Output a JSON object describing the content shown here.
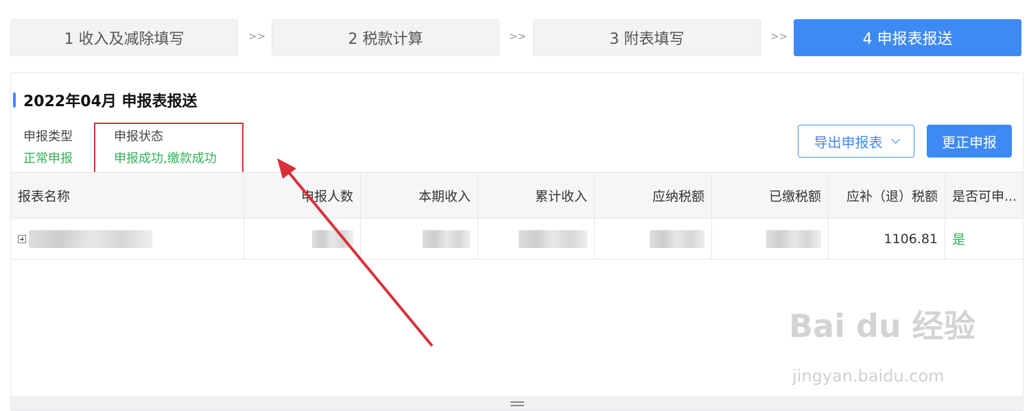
{
  "steps": [
    {
      "label": "1 收入及减除填写"
    },
    {
      "label": "2 税款计算"
    },
    {
      "label": "3 附表填写"
    },
    {
      "label": "4 申报表报送"
    }
  ],
  "step_separator": ">>",
  "panel": {
    "title": "2022年04月  申报表报送",
    "type_label": "申报类型",
    "type_value": "正常申报",
    "status_label": "申报状态",
    "status_value": "申报成功,缴款成功",
    "export_button": "导出申报表",
    "correct_button": "更正申报"
  },
  "table": {
    "headers": [
      "报表名称",
      "申报人数",
      "本期收入",
      "累计收入",
      "应纳税额",
      "已缴税额",
      "应补（退）税额",
      "是否可申..."
    ],
    "rows": [
      {
        "tax_due": "1106.81",
        "can_declare": "是"
      }
    ]
  },
  "watermark": {
    "brand": "Bai du 经验",
    "url": "jingyan.baidu.com"
  },
  "colors": {
    "accent": "#3d8af5",
    "success": "#2fb256",
    "highlight": "#d9303a"
  }
}
